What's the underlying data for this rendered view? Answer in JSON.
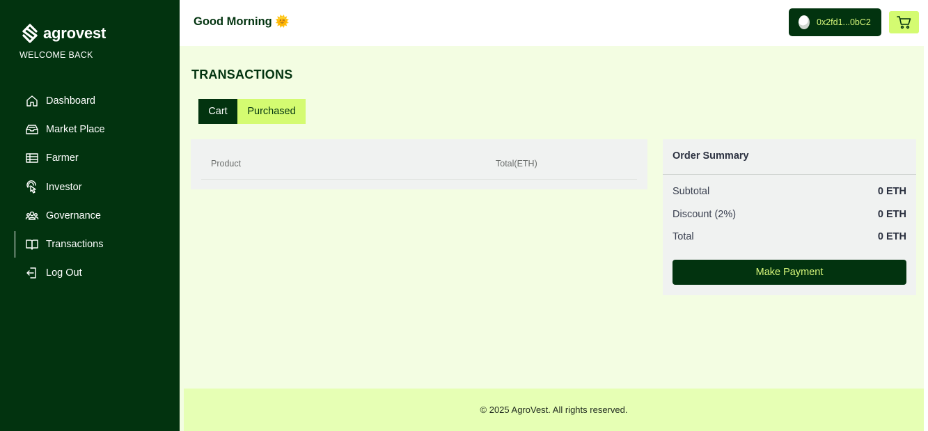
{
  "app": {
    "brand": "agrovest",
    "welcome": "WELCOME BACK"
  },
  "sidebar": {
    "items": [
      {
        "label": "Dashboard",
        "icon": "home-icon"
      },
      {
        "label": "Market Place",
        "icon": "inbox-icon"
      },
      {
        "label": "Farmer",
        "icon": "table-icon"
      },
      {
        "label": "Investor",
        "icon": "pointer-icon"
      },
      {
        "label": "Governance",
        "icon": "users-icon"
      },
      {
        "label": "Transactions",
        "icon": "book-icon",
        "active": true
      },
      {
        "label": "Log Out",
        "icon": "logout-icon"
      }
    ]
  },
  "header": {
    "greeting": "Good Morning 🌞",
    "wallet_address": "0x2fd1...0bC2",
    "cart_icon": "cart-icon"
  },
  "main": {
    "title": "TRANSACTIONS",
    "tabs": [
      {
        "label": "Cart",
        "selected": true
      },
      {
        "label": "Purchased",
        "selected": false
      }
    ],
    "table": {
      "columns": [
        "Product",
        "Total(ETH)"
      ],
      "rows": []
    },
    "order_summary": {
      "title": "Order Summary",
      "subtotal_label": "Subtotal",
      "subtotal_value": "0 ETH",
      "discount_label": "Discount (2%)",
      "discount_value": "0 ETH",
      "total_label": "Total",
      "total_value": "0 ETH",
      "pay_button": "Make Payment"
    }
  },
  "footer": {
    "text": "© 2025 AgroVest. All rights reserved."
  },
  "colors": {
    "sidebar_bg": "#02330f",
    "accent_lime": "#d4fb71",
    "page_bg": "#f3fde2",
    "footer_bg": "#e6ffb4"
  }
}
